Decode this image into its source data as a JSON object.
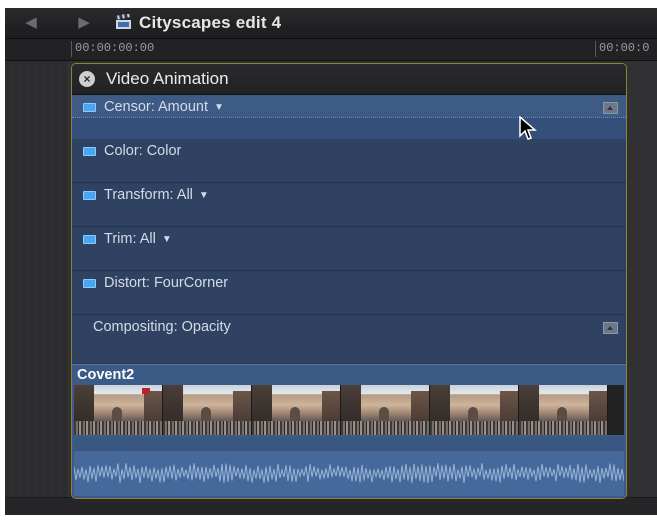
{
  "window": {
    "title": "Cityscapes edit 4"
  },
  "ruler": {
    "start_timecode": "00:00:00:00",
    "next_timecode": "00:00:0"
  },
  "video_animation": {
    "title": "Video Animation",
    "rows": [
      {
        "label": "Censor: Amount",
        "has_menu": true,
        "selected": true
      },
      {
        "label": "Color: Color",
        "has_menu": false
      },
      {
        "label": "Transform: All",
        "has_menu": true
      },
      {
        "label": "Trim: All",
        "has_menu": true
      },
      {
        "label": "Distort: FourCorner",
        "has_menu": false
      },
      {
        "label": "Compositing: Opacity",
        "has_menu": false
      }
    ]
  },
  "clip": {
    "name": "Covent2",
    "thumbnail_count": 6
  },
  "colors": {
    "accent_border": "#8a8435",
    "row_bg": "#2f4262",
    "selected_row_bg": "#3d5b85",
    "clip_bg": "#3c5a86"
  },
  "icons": {
    "back": "back-arrow-icon",
    "forward": "forward-arrow-icon",
    "project": "clapperboard-icon",
    "close": "close-icon",
    "effect": "effect-toggle-icon",
    "expand": "expand-keyframes-icon",
    "cursor": "mouse-pointer-icon"
  }
}
